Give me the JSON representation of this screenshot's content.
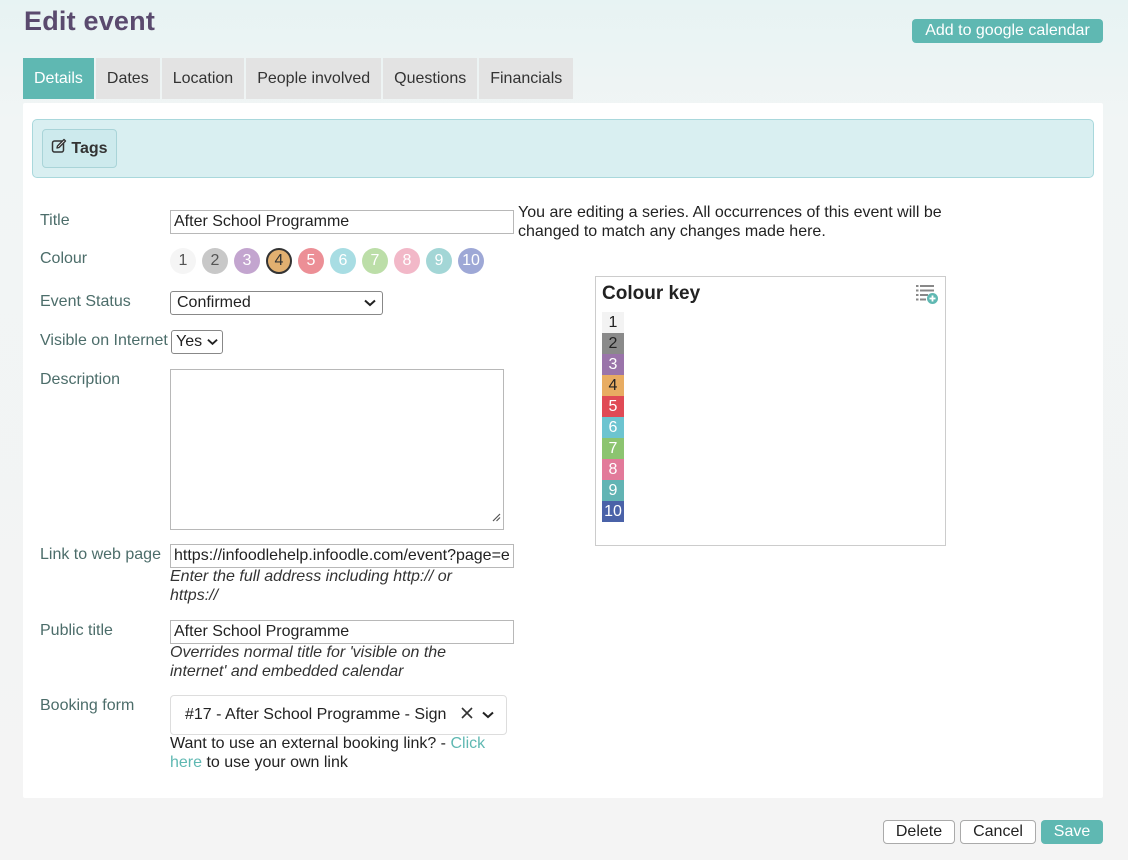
{
  "header": {
    "title": "Edit event",
    "google_calendar_button": "Add to google calendar"
  },
  "tabs": [
    {
      "label": "Details",
      "active": true
    },
    {
      "label": "Dates",
      "active": false
    },
    {
      "label": "Location",
      "active": false
    },
    {
      "label": "People involved",
      "active": false
    },
    {
      "label": "Questions",
      "active": false
    },
    {
      "label": "Financials",
      "active": false
    }
  ],
  "tags": {
    "button_label": "Tags",
    "icon": "edit-icon"
  },
  "form": {
    "title_label": "Title",
    "title_value": "After School Programme",
    "series_note": "You are editing a series. All occurrences of this event will be changed to match any changes made here.",
    "colour_label": "Colour",
    "colours": [
      {
        "num": "1",
        "bg": "#f5f5f5",
        "fg": "#555555"
      },
      {
        "num": "2",
        "bg": "#c8c8c8",
        "fg": "#555555"
      },
      {
        "num": "3",
        "bg": "#c3a5cf",
        "fg": "#ffffff"
      },
      {
        "num": "4",
        "bg": "#e2b070",
        "fg": "#333333",
        "selected": true
      },
      {
        "num": "5",
        "bg": "#ec8f96",
        "fg": "#ffffff"
      },
      {
        "num": "6",
        "bg": "#a8dde3",
        "fg": "#ffffff"
      },
      {
        "num": "7",
        "bg": "#bcdea8",
        "fg": "#ffffff"
      },
      {
        "num": "8",
        "bg": "#f2b8c8",
        "fg": "#ffffff"
      },
      {
        "num": "9",
        "bg": "#a3d6d6",
        "fg": "#ffffff"
      },
      {
        "num": "10",
        "bg": "#9ea8d6",
        "fg": "#ffffff"
      }
    ],
    "status_label": "Event Status",
    "status_value": "Confirmed",
    "visible_label": "Visible on Internet",
    "visible_value": "Yes",
    "description_label": "Description",
    "description_value": "",
    "link_label": "Link to web page",
    "link_value": "https://infoodlehelp.infoodle.com/event?page=e",
    "link_hint": "Enter the full address including http:// or https://",
    "public_title_label": "Public title",
    "public_title_value": "After School Programme",
    "public_title_hint": "Overrides normal title for 'visible on the internet' and embedded calendar",
    "booking_label": "Booking form",
    "booking_value": "#17 - After School Programme - Sign",
    "booking_note_prefix": "Want to use an external booking link? - ",
    "booking_note_link": "Click here",
    "booking_note_suffix": " to use your own link"
  },
  "colour_key": {
    "title": "Colour key",
    "icon": "list-add-icon",
    "items": [
      {
        "num": "1",
        "bg": "#f3f3f3",
        "fg": "#222222"
      },
      {
        "num": "2",
        "bg": "#8a8a8a",
        "fg": "#222222"
      },
      {
        "num": "3",
        "bg": "#9a74aa",
        "fg": "#ffffff"
      },
      {
        "num": "4",
        "bg": "#e8ac62",
        "fg": "#222222"
      },
      {
        "num": "5",
        "bg": "#e04a55",
        "fg": "#ffffff"
      },
      {
        "num": "6",
        "bg": "#6cc4d0",
        "fg": "#ffffff"
      },
      {
        "num": "7",
        "bg": "#8cc470",
        "fg": "#ffffff"
      },
      {
        "num": "8",
        "bg": "#e27a9a",
        "fg": "#ffffff"
      },
      {
        "num": "9",
        "bg": "#62b4b4",
        "fg": "#ffffff"
      },
      {
        "num": "10",
        "bg": "#4a62a8",
        "fg": "#ffffff"
      }
    ]
  },
  "footer": {
    "delete_label": "Delete",
    "cancel_label": "Cancel",
    "save_label": "Save"
  }
}
